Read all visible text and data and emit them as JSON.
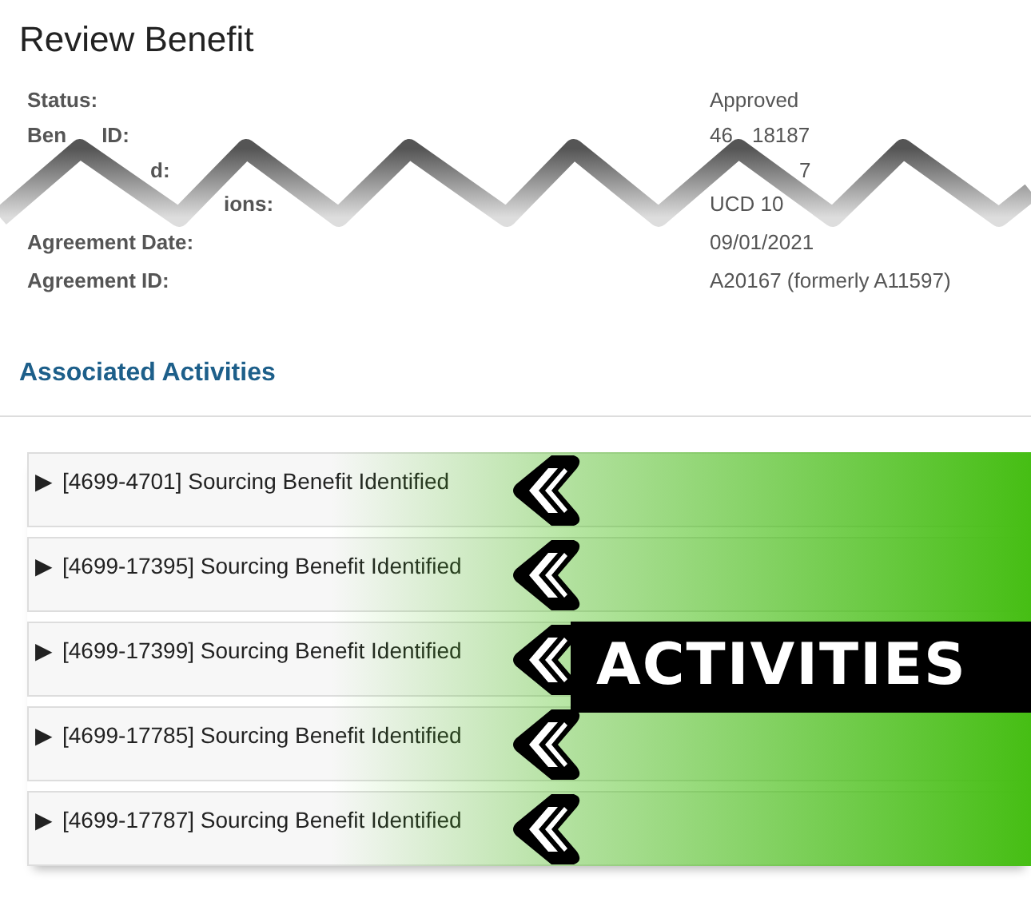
{
  "title": "Review Benefit",
  "details": [
    {
      "label_parts": [
        "Status:"
      ],
      "value_parts": [
        "Approved"
      ]
    },
    {
      "label_parts": [
        "Ben",
        "ID:"
      ],
      "value_parts": [
        "46",
        "18187"
      ]
    },
    {
      "label_parts": [
        "d:"
      ],
      "value_parts": [
        "7"
      ]
    },
    {
      "label_parts": [
        "ions:"
      ],
      "value_parts": [
        "UCD 10"
      ]
    },
    {
      "label_parts": [
        "Agreement Date:"
      ],
      "value_parts": [
        "09/01/2021"
      ]
    },
    {
      "label_parts": [
        "Agreement ID:"
      ],
      "value_parts": [
        "A20167 (formerly A11597)"
      ]
    }
  ],
  "section_title": "Associated Activities",
  "activities": [
    {
      "toggle": "▶",
      "label": "[4699-4701] Sourcing Benefit Identified"
    },
    {
      "toggle": "▶",
      "label": "[4699-17395] Sourcing Benefit Identified"
    },
    {
      "toggle": "▶",
      "label": "[4699-17399] Sourcing Benefit Identified"
    },
    {
      "toggle": "▶",
      "label": "[4699-17785] Sourcing Benefit Identified"
    },
    {
      "toggle": "▶",
      "label": "[4699-17787] Sourcing Benefit Identified"
    }
  ],
  "annotation": {
    "label": "ACTIVITIES"
  }
}
